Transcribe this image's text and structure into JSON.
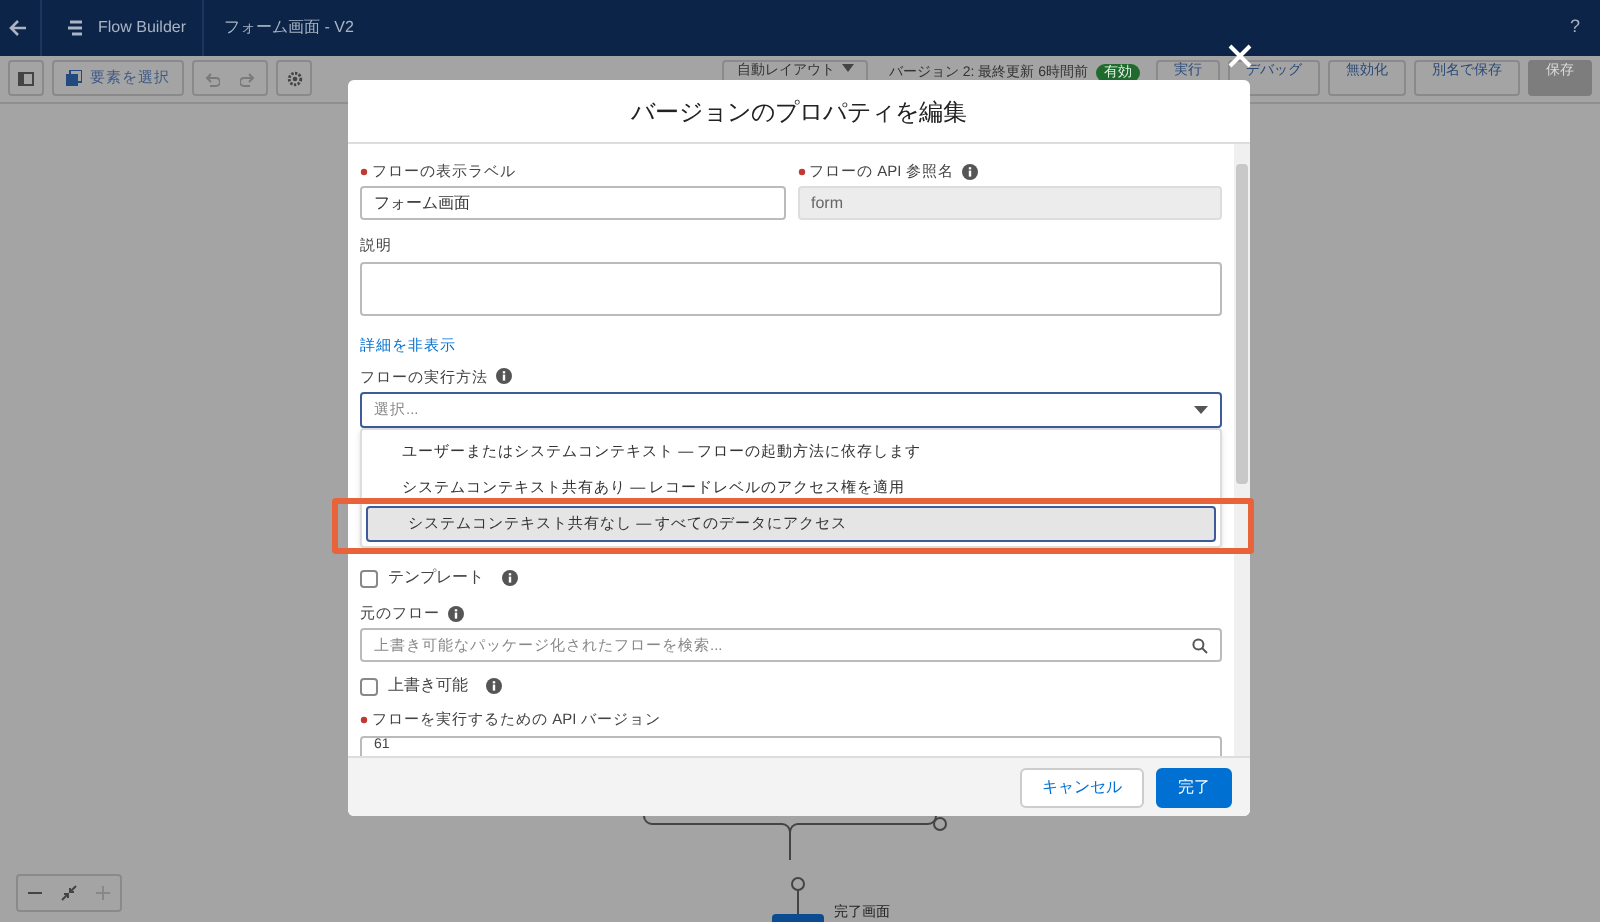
{
  "header": {
    "app_title": "Flow Builder",
    "flow_name": "フォーム画面 - V2",
    "help": "?"
  },
  "toolbar": {
    "select_button": "要素を選択",
    "layout_button": "自動レイアウト",
    "version_info": "バージョン 2: 最終更新 6時間前",
    "status_badge": "有効",
    "actions": [
      {
        "label": "実行",
        "disabled": false
      },
      {
        "label": "デバッグ",
        "disabled": false
      },
      {
        "label": "無効化",
        "disabled": false
      },
      {
        "label": "別名で保存",
        "disabled": false
      },
      {
        "label": "保存",
        "disabled": true
      }
    ]
  },
  "modal": {
    "title": "バージョンのプロパティを編集",
    "label_field": {
      "label": "フローの表示ラベル",
      "required": true,
      "value": "フォーム画面"
    },
    "api_name_field": {
      "label": "フローの API 参照名",
      "required": true,
      "value": "form",
      "disabled": true
    },
    "description_field": {
      "label": "説明"
    },
    "details_link": "詳細を非表示",
    "run_mode": {
      "label": "フローの実行方法",
      "placeholder": "選択...",
      "expanded": true,
      "options": [
        {
          "label": "ユーザーまたはシステムコンテキスト — フローの起動方法に依存します",
          "selected": false
        },
        {
          "label": "システムコンテキスト共有あり — レコードレベルのアクセス権を適用",
          "selected": false
        },
        {
          "label": "システムコンテキスト共有なし — すべてのデータにアクセス",
          "selected": true
        }
      ]
    },
    "template": {
      "label": "テンプレート",
      "checked": false
    },
    "source_flow": {
      "label": "元のフロー",
      "placeholder": "上書き可能なパッケージ化されたフローを検索..."
    },
    "overridable": {
      "label": "上書き可能",
      "checked": false
    },
    "api_version": {
      "label": "フローを実行するための API バージョン",
      "required": true,
      "value": "61"
    },
    "buttons": [
      {
        "label": "キャンセル",
        "kind": "neutral"
      },
      {
        "label": "完了",
        "kind": "brand"
      }
    ]
  },
  "canvas": {
    "node_label": "完了画面"
  }
}
